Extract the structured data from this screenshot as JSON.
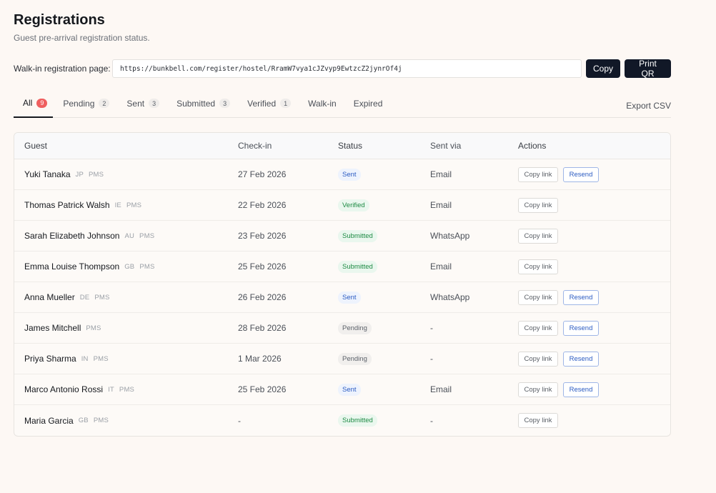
{
  "header": {
    "title": "Registrations",
    "subtitle": "Guest pre-arrival registration status."
  },
  "walkin": {
    "label": "Walk-in registration page:",
    "url": "https://bunkbell.com/register/hostel/RramW7vya1cJZvyp9EwtzcZ2jynrOf4j",
    "copy_label": "Copy",
    "print_label": "Print QR"
  },
  "tabs": [
    {
      "label": "All",
      "count": "9"
    },
    {
      "label": "Pending",
      "count": "2"
    },
    {
      "label": "Sent",
      "count": "3"
    },
    {
      "label": "Submitted",
      "count": "3"
    },
    {
      "label": "Verified",
      "count": "1"
    },
    {
      "label": "Walk-in",
      "count": ""
    },
    {
      "label": "Expired",
      "count": ""
    }
  ],
  "export_label": "Export CSV",
  "table": {
    "columns": [
      "Guest",
      "Check-in",
      "Status",
      "Sent via",
      "Actions"
    ],
    "copy_link_label": "Copy link",
    "resend_label": "Resend",
    "rows": [
      {
        "name": "Yuki Tanaka",
        "country": "JP",
        "source": "PMS",
        "checkin": "27 Feb 2026",
        "status": "Sent",
        "sent_via": "Email",
        "resend": true
      },
      {
        "name": "Thomas Patrick Walsh",
        "country": "IE",
        "source": "PMS",
        "checkin": "22 Feb 2026",
        "status": "Verified",
        "sent_via": "Email",
        "resend": false
      },
      {
        "name": "Sarah Elizabeth Johnson",
        "country": "AU",
        "source": "PMS",
        "checkin": "23 Feb 2026",
        "status": "Submitted",
        "sent_via": "WhatsApp",
        "resend": false
      },
      {
        "name": "Emma Louise Thompson",
        "country": "GB",
        "source": "PMS",
        "checkin": "25 Feb 2026",
        "status": "Submitted",
        "sent_via": "Email",
        "resend": false
      },
      {
        "name": "Anna Mueller",
        "country": "DE",
        "source": "PMS",
        "checkin": "26 Feb 2026",
        "status": "Sent",
        "sent_via": "WhatsApp",
        "resend": true
      },
      {
        "name": "James Mitchell",
        "country": "",
        "source": "PMS",
        "checkin": "28 Feb 2026",
        "status": "Pending",
        "sent_via": "-",
        "resend": true
      },
      {
        "name": "Priya Sharma",
        "country": "IN",
        "source": "PMS",
        "checkin": "1 Mar 2026",
        "status": "Pending",
        "sent_via": "-",
        "resend": true
      },
      {
        "name": "Marco Antonio Rossi",
        "country": "IT",
        "source": "PMS",
        "checkin": "25 Feb 2026",
        "status": "Sent",
        "sent_via": "Email",
        "resend": true
      },
      {
        "name": "Maria Garcia",
        "country": "GB",
        "source": "PMS",
        "checkin": "-",
        "status": "Submitted",
        "sent_via": "-",
        "resend": false
      }
    ]
  },
  "colors": {
    "background": "#fdf8f4",
    "primary_button": "#111827",
    "badge_red": "#ef5f5f",
    "status_sent": "#2b5bc2",
    "status_success": "#1d8a43"
  }
}
